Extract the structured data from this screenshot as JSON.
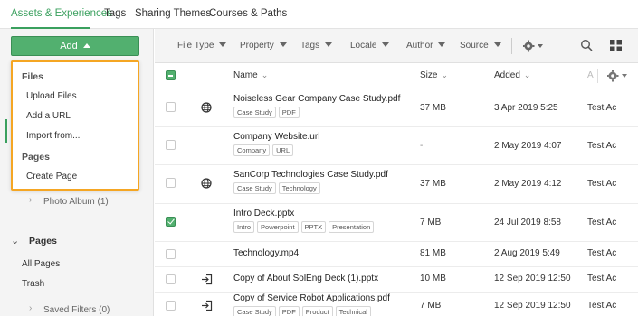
{
  "top_tabs": [
    {
      "label": "Assets & Experiences",
      "active": true
    },
    {
      "label": "Tags",
      "active": false
    },
    {
      "label": "Sharing Themes",
      "active": false
    },
    {
      "label": "Courses & Paths",
      "active": false
    }
  ],
  "sidebar": {
    "add_label": "Add",
    "photo_album": "Photo Album (1)",
    "pages_heading": "Pages",
    "all_pages": "All Pages",
    "trash": "Trash",
    "saved_filters": "Saved Filters (0)"
  },
  "add_menu": {
    "files_heading": "Files",
    "upload_files": "Upload Files",
    "add_url": "Add a URL",
    "import_from": "Import from...",
    "pages_heading": "Pages",
    "create_page": "Create Page"
  },
  "toolbar": {
    "filters": [
      "File Type",
      "Property",
      "Tags",
      "Locale",
      "Author",
      "Source"
    ]
  },
  "table": {
    "headers": {
      "name": "Name",
      "size": "Size",
      "added": "Added",
      "author_initial": "A"
    },
    "rows": [
      {
        "name": "Noiseless Gear Company Case Study.pdf",
        "tags": [
          "Case Study",
          "PDF"
        ],
        "size": "37 MB",
        "added": "3 Apr 2019 5:25",
        "author": "Test Ac",
        "icon": "globe-icon",
        "checked": false
      },
      {
        "name": "Company Website.url",
        "tags": [
          "Company",
          "URL"
        ],
        "size": "-",
        "added": "2 May 2019 4:07",
        "author": "Test Ac",
        "icon": "",
        "checked": false
      },
      {
        "name": "SanCorp Technologies Case Study.pdf",
        "tags": [
          "Case Study",
          "Technology"
        ],
        "size": "37 MB",
        "added": "2 May 2019 4:12",
        "author": "Test Ac",
        "icon": "globe-icon",
        "checked": false
      },
      {
        "name": "Intro Deck.pptx",
        "tags": [
          "Intro",
          "Powerpoint",
          "PPTX",
          "Presentation"
        ],
        "size": "7 MB",
        "added": "24 Jul 2019 8:58",
        "author": "Test Ac",
        "icon": "",
        "checked": true
      },
      {
        "name": "Technology.mp4",
        "tags": [],
        "size": "81 MB",
        "added": "2 Aug 2019 5:49",
        "author": "Test Ac",
        "icon": "",
        "checked": false
      },
      {
        "name": "Copy of About SolEng Deck (1).pptx",
        "tags": [],
        "size": "10 MB",
        "added": "12 Sep 2019 12:50",
        "author": "Test Ac",
        "icon": "login-icon",
        "checked": false
      },
      {
        "name": "Copy of Service Robot Applications.pdf",
        "tags": [
          "Case Study",
          "PDF",
          "Product",
          "Technical"
        ],
        "size": "7 MB",
        "added": "12 Sep 2019 12:50",
        "author": "Test Ac",
        "icon": "login-icon",
        "checked": false
      }
    ]
  },
  "colors": {
    "accent": "#3aa05e",
    "highlight": "#f5a623"
  }
}
